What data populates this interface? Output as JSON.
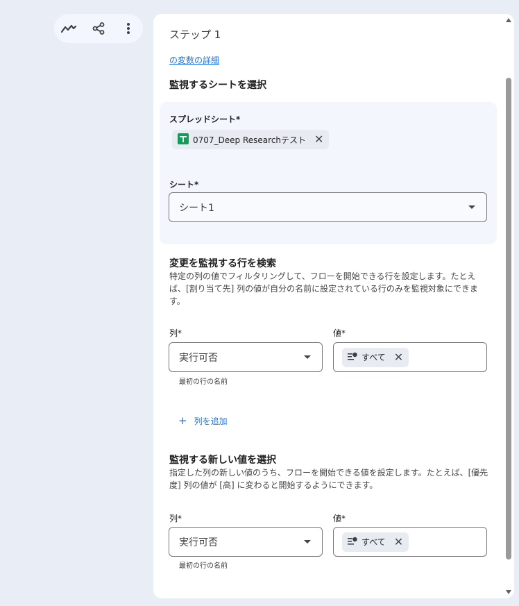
{
  "toolbar": {
    "icons": [
      "trend-icon",
      "share-icon",
      "more-vert-icon"
    ]
  },
  "step": {
    "title": "ステップ 1",
    "variables_link": "の変数の詳細"
  },
  "select_sheet": {
    "heading": "監視するシートを選択",
    "spreadsheet_label": "スプレッドシート*",
    "spreadsheet_chip": "0707_Deep Researchテスト",
    "spreadsheet_remove": "✕",
    "sheet_label": "シート*",
    "sheet_value": "シート1"
  },
  "row_filter": {
    "heading": "変更を監視する行を検索",
    "description": "特定の列の値でフィルタリングして、フローを開始できる行を設定します。たとえば、[割り当て先] 列の値が自分の名前に設定されている行のみを監視対象にできます。",
    "column_label": "列*",
    "column_value": "実行可否",
    "column_helper": "最初の行の名前",
    "value_label": "値*",
    "value_chip": "すべて",
    "value_remove": "✕",
    "add_column": "列を追加",
    "add_icon": "+"
  },
  "new_value": {
    "heading": "監視する新しい値を選択",
    "description": "指定した列の新しい値のうち、フローを開始できる値を設定します。たとえば、[優先度] 列の値が [高] に変わると開始するようにできます。",
    "column_label": "列*",
    "column_value": "実行可否",
    "column_helper": "最初の行の名前",
    "value_label": "値*",
    "value_chip": "すべて",
    "value_remove": "✕"
  },
  "colors": {
    "background": "#e8edf6",
    "panel": "#ffffff",
    "card": "#f3f6fc",
    "link": "#1a73e8",
    "sheets_green": "#0f9d58"
  }
}
